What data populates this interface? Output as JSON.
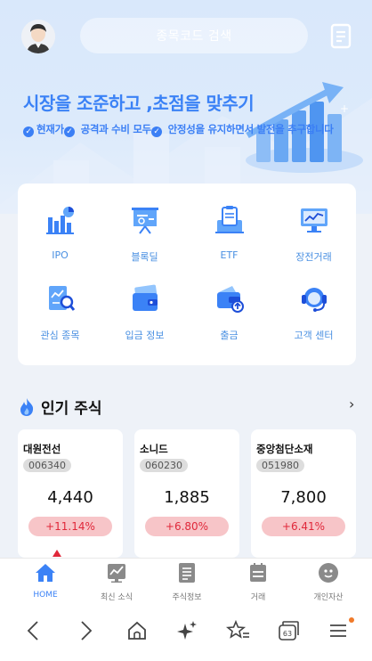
{
  "header": {
    "search_placeholder": "종목코드 검색"
  },
  "banner": {
    "headline": "시장을 조준하고 ,초점을 맞추기",
    "tagline_parts": [
      "현재가",
      "공격과 수비 모두",
      "안정성을 유지하면서 발전을 추구합니다"
    ]
  },
  "menu": {
    "items": [
      {
        "label": "IPO",
        "icon": "bar-chart-icon"
      },
      {
        "label": "블록딜",
        "icon": "presentation-board-icon"
      },
      {
        "label": "ETF",
        "icon": "clipboard-computer-icon"
      },
      {
        "label": "장전거래",
        "icon": "monitor-chart-icon"
      },
      {
        "label": "관심 종목",
        "icon": "magnifier-report-icon"
      },
      {
        "label": "입금 정보",
        "icon": "card-wallet-icon"
      },
      {
        "label": "출금",
        "icon": "wallet-upload-icon"
      },
      {
        "label": "고객 센터",
        "icon": "headset-icon"
      }
    ]
  },
  "popular": {
    "title": "인기 주식",
    "more": "›",
    "stocks": [
      {
        "name": "대원전선",
        "code": "006340",
        "price": "4,440",
        "change": "+11.14%"
      },
      {
        "name": "소니드",
        "code": "060230",
        "price": "1,885",
        "change": "+6.80%"
      },
      {
        "name": "중앙첨단소재",
        "code": "051980",
        "price": "7,800",
        "change": "+6.41%"
      }
    ]
  },
  "tabbar": {
    "tabs": [
      {
        "label": "HOME",
        "icon": "home-icon",
        "active": true
      },
      {
        "label": "최신 소식",
        "icon": "news-chart-icon",
        "active": false
      },
      {
        "label": "주식정보",
        "icon": "document-icon",
        "active": false
      },
      {
        "label": "거래",
        "icon": "trade-list-icon",
        "active": false
      },
      {
        "label": "개인자산",
        "icon": "profile-icon",
        "active": false
      }
    ]
  },
  "colors": {
    "accent": "#3b82f6",
    "rise": "#e0283a",
    "rise_bg": "#f7c5c8"
  }
}
